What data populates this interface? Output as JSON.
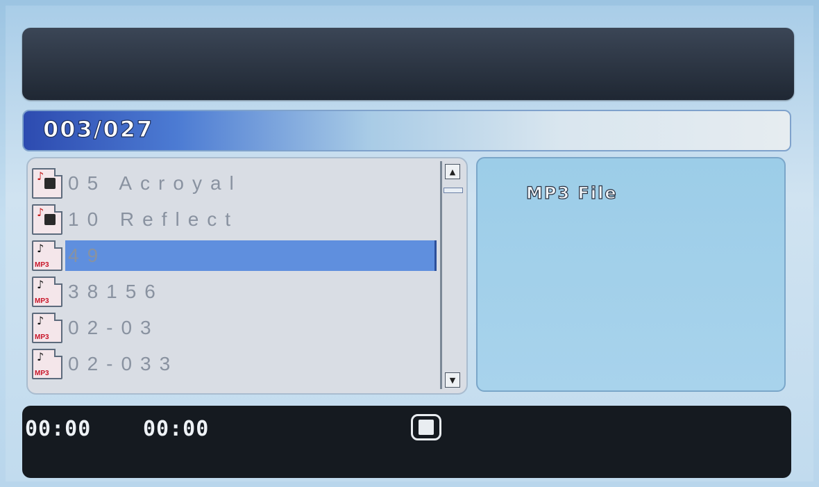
{
  "player": {
    "track_counter": "003/027"
  },
  "file_list": {
    "items": [
      {
        "name": "05 Acroyal",
        "icon": "music-file-icon",
        "selected": false
      },
      {
        "name": "10 Reflect",
        "icon": "music-file-icon",
        "selected": false
      },
      {
        "name": "49",
        "icon": "mp3-file-icon",
        "selected": true
      },
      {
        "name": "38156",
        "icon": "mp3-file-icon",
        "selected": false
      },
      {
        "name": "02-03",
        "icon": "mp3-file-icon",
        "selected": false
      },
      {
        "name": "02-033",
        "icon": "mp3-file-icon",
        "selected": false
      }
    ],
    "mp3_label": "MP3"
  },
  "info_panel": {
    "file_type": "MP3 File"
  },
  "status": {
    "elapsed": "00:00",
    "total": "00:00",
    "playback_icon": "stop-icon"
  },
  "colors": {
    "selection": "#5f8fde",
    "title_bar": "#2a3442",
    "status_bar": "#151a20"
  }
}
